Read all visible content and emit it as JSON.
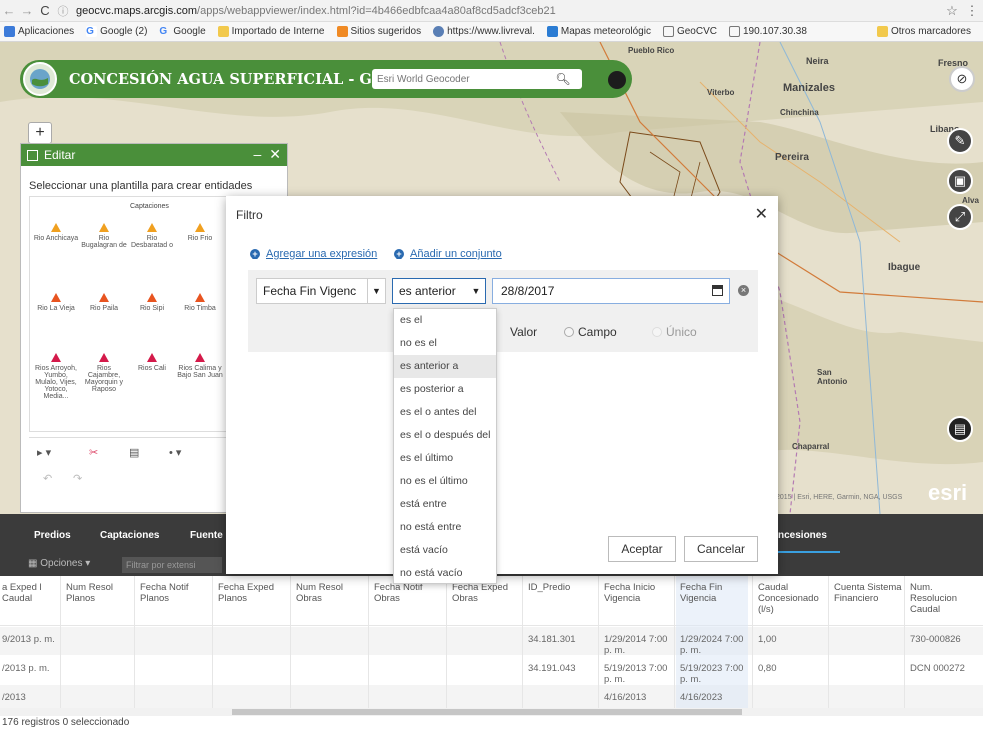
{
  "browser": {
    "url_host": "geocvc.maps.arcgis.com",
    "url_path": "/apps/webappviewer/index.html?id=4b466edbfcaa4a80af8cd5adcf3ceb21",
    "bookmarks": [
      "Aplicaciones",
      "Google (2)",
      "Google",
      "Importado de Interne",
      "Sitios sugeridos",
      "https://www.livreval.",
      "Mapas meteorológic",
      "GeoCVC",
      "190.107.30.38",
      "Otros marcadores"
    ]
  },
  "header": {
    "title": "CONCESIÓN AGUA SUPERFICIAL - GEOCVC",
    "geocoder_placeholder": "Esri World Geocoder"
  },
  "map_labels": [
    "Pueblo Rico",
    "Neira",
    "Manizales",
    "Chinchina",
    "Viterbo",
    "Pereira",
    "Libano",
    "Ibague",
    "San Antonio",
    "Chaparral",
    "Fresno",
    "Alva"
  ],
  "map_attribution": "2015 | Esri, HERE, Garmin, NGA, USGS",
  "edit_panel": {
    "title": "Editar",
    "hint": "Seleccionar una plantilla para crear entidades",
    "group_title": "Captaciones",
    "templates_row1": [
      "Rio Anchicaya",
      "Rio Bugalagran de",
      "Rio Desbaratad o",
      "Rio Frio"
    ],
    "templates_row2": [
      "Rio La Vieja",
      "Rio Paila",
      "Rio Sipi",
      "Rio Timba"
    ],
    "templates_row3": [
      "Rios Arroyoh, Yumbo, Mulalo, Vijes, Yotoco, Media...",
      "Rios Cajambre, Mayorquin y Raposo",
      "Rios Cali",
      "Rios Calima y Bajo San Juan"
    ]
  },
  "tabs": [
    "Predios",
    "Captaciones",
    "Fuente",
    "ncesiones"
  ],
  "options": {
    "label": "Opciones",
    "filter_placeholder": "Filtrar por extensi"
  },
  "table": {
    "headers": [
      "a Exped l Caudal",
      "Num Resol Planos",
      "Fecha Notif Planos",
      "Fecha Exped Planos",
      "Num Resol Obras",
      "Fecha Notif Obras",
      "Fecha Exped Obras",
      "ID_Predio",
      "Fecha Inicio Vigencia",
      "Fecha Fin Vigencia",
      "Caudal Concesionado (l/s)",
      "Cuenta Sistema Financiero",
      "Num. Resolucion Caudal"
    ],
    "rows": [
      [
        "9/2013 p. m.",
        "",
        "",
        "",
        "",
        "",
        "",
        "34.181.301",
        "1/29/2014 7:00 p. m.",
        "1/29/2024 7:00 p. m.",
        "1,00",
        "",
        "730-000826"
      ],
      [
        "/2013 p. m.",
        "",
        "",
        "",
        "",
        "",
        "",
        "34.191.043",
        "5/19/2013 7:00 p. m.",
        "5/19/2023 7:00 p. m.",
        "0,80",
        "",
        "DCN 000272"
      ],
      [
        "/2013",
        "",
        "",
        "",
        "",
        "",
        "",
        "",
        "4/16/2013",
        "4/16/2023",
        "",
        "",
        ""
      ]
    ],
    "status": "176 registros   0 seleccionado"
  },
  "dialog": {
    "title": "Filtro",
    "add_expression": "Agregar una expresión",
    "add_set": "Añadir un conjunto",
    "field_value": "Fecha Fin Vigenc",
    "operator_value": "es anterior",
    "date_value": "28/8/2017",
    "radio_valor": "Valor",
    "radio_campo": "Campo",
    "radio_unico": "Único",
    "accept": "Aceptar",
    "cancel": "Cancelar",
    "operators": [
      "es el",
      "no es el",
      "es anterior a",
      "es posterior a",
      "es el o antes del",
      "es el o después del",
      "es el último",
      "no es el último",
      "está entre",
      "no está entre",
      "está vacío",
      "no está vacío"
    ],
    "selected_operator": "es anterior a"
  },
  "colors": {
    "header_green": "#4a8f3a",
    "link_blue": "#2a6ab0",
    "tab_bar": "#3b3b3b"
  }
}
